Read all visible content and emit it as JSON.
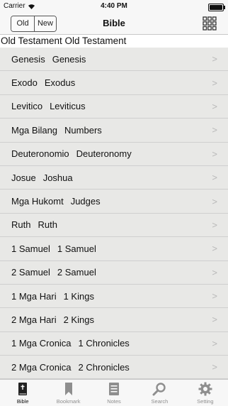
{
  "status_bar": {
    "carrier": "Carrier",
    "time": "4:40 PM"
  },
  "nav": {
    "segment_old": "Old",
    "segment_new": "New",
    "title": "Bible"
  },
  "section": {
    "title": "Old Testament  Old Testament"
  },
  "books": [
    {
      "local": "Genesis",
      "english": "Genesis"
    },
    {
      "local": "Exodo",
      "english": "Exodus"
    },
    {
      "local": "Levitico",
      "english": "Leviticus"
    },
    {
      "local": "Mga Bilang",
      "english": "Numbers"
    },
    {
      "local": "Deuteronomio",
      "english": "Deuteronomy"
    },
    {
      "local": "Josue",
      "english": "Joshua"
    },
    {
      "local": "Mga Hukomt",
      "english": "Judges"
    },
    {
      "local": "Ruth",
      "english": "Ruth"
    },
    {
      "local": "1 Samuel",
      "english": "1 Samuel"
    },
    {
      "local": "2 Samuel",
      "english": "2 Samuel"
    },
    {
      "local": "1 Mga Hari",
      "english": "1 Kings"
    },
    {
      "local": "2 Mga Hari",
      "english": "2 Kings"
    },
    {
      "local": "1 Mga Cronica",
      "english": "1 Chronicles"
    },
    {
      "local": "2 Mga Cronica",
      "english": "2 Chronicles"
    }
  ],
  "chevron_glyph": ">",
  "tabs": [
    {
      "label": "Bible",
      "icon": "bible-book-icon",
      "active": true
    },
    {
      "label": "Bookmark",
      "icon": "bookmark-icon",
      "active": false
    },
    {
      "label": "Notes",
      "icon": "notes-icon",
      "active": false
    },
    {
      "label": "Search",
      "icon": "search-icon",
      "active": false
    },
    {
      "label": "Setting",
      "icon": "gear-icon",
      "active": false
    }
  ]
}
